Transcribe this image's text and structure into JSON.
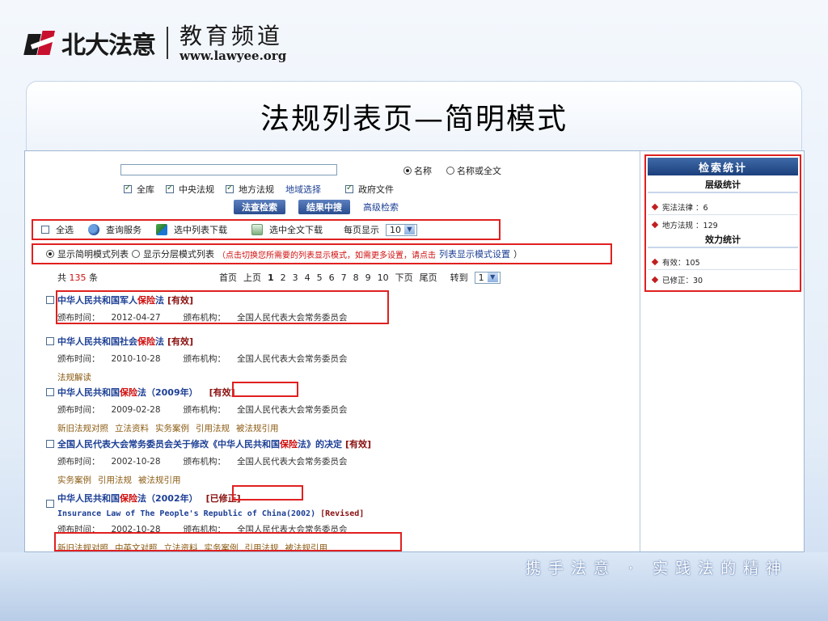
{
  "header": {
    "brand": "北大法意",
    "channel": "教育频道",
    "url": "www.lawyee.org"
  },
  "slide_title": "法规列表页—简明模式",
  "search": {
    "radio_name": "名称",
    "radio_fulltext": "名称或全文",
    "check_all": "全库",
    "check_central": "中央法规",
    "check_local": "地方法规",
    "link_region": "地域选择",
    "check_gov": "政府文件",
    "btn_search": "法查检索",
    "btn_in_results": "结果中搜",
    "link_advanced": "高级检索"
  },
  "toolbar": {
    "select_all": "全选",
    "query_service": "查询服务",
    "download_list": "选中列表下载",
    "download_full": "选中全文下载",
    "per_page_label": "每页显示",
    "per_page_value": "10"
  },
  "mode_bar": {
    "simple_mode": "显示简明模式列表",
    "layered_mode": "显示分层模式列表",
    "hint_prefix": "（点击切换您所需要的列表显示模式，如需更多设置，请点击",
    "hint_link": "列表显示模式设置",
    "hint_suffix": "）"
  },
  "pager": {
    "total_prefix": "共",
    "total_count": "135",
    "total_suffix": "条",
    "first": "首页",
    "prev": "上页",
    "pages": [
      "1",
      "2",
      "3",
      "4",
      "5",
      "6",
      "7",
      "8",
      "9",
      "10"
    ],
    "next": "下页",
    "last": "尾页",
    "goto_label": "转到",
    "goto_value": "1"
  },
  "records": [
    {
      "title_pre": "中华人民共和国军人",
      "title_hl": "保险",
      "title_post": "法",
      "status": "[有效]",
      "date_label": "颁布时间：",
      "date": "2012-04-27",
      "org_label": "颁布机构：",
      "org": "全国人民代表大会常务委员会",
      "links": []
    },
    {
      "title_pre": "中华人民共和国社会",
      "title_hl": "保险",
      "title_post": "法",
      "status": "[有效]",
      "date_label": "颁布时间：",
      "date": "2010-10-28",
      "org_label": "颁布机构：",
      "org": "全国人民代表大会常务委员会",
      "links": [
        "法规解读"
      ]
    },
    {
      "title_pre": "中华人民共和国",
      "title_hl": "保险",
      "title_post": "法（2009年）",
      "status": "[有效]",
      "date_label": "颁布时间：",
      "date": "2009-02-28",
      "org_label": "颁布机构：",
      "org": "全国人民代表大会常务委员会",
      "links": [
        "新旧法规对照",
        "立法资料",
        "实务案例",
        "引用法规",
        "被法规引用"
      ]
    },
    {
      "title_pre": "全国人民代表大会常务委员会关于修改《中华人民共和国",
      "title_hl": "保险",
      "title_post": "法》的决定",
      "status": "[有效]",
      "date_label": "颁布时间：",
      "date": "2002-10-28",
      "org_label": "颁布机构：",
      "org": "全国人民代表大会常务委员会",
      "links": [
        "实务案例",
        "引用法规",
        "被法规引用"
      ]
    },
    {
      "title_pre": "中华人民共和国",
      "title_hl": "保险",
      "title_post": "法（2002年）",
      "status": "[已修正]",
      "en_title": "Insurance Law of The People's Republic of China(2002)",
      "en_status": "[Revised]",
      "date_label": "颁布时间：",
      "date": "2002-10-28",
      "org_label": "颁布机构：",
      "org": "全国人民代表大会常务委员会",
      "links": [
        "新旧法规对照",
        "中英文对照",
        "立法资料",
        "实务案例",
        "引用法规",
        "被法规引用"
      ]
    }
  ],
  "sidebar": {
    "title": "检索统计",
    "level_title": "层级统计",
    "level_items": [
      "宪法法律 ：6",
      "地方法规 ：129"
    ],
    "effect_title": "效力统计",
    "effect_items": [
      "有效：105",
      "已修正：30"
    ]
  },
  "footer": {
    "slogan": "携手法意 · 实践法的精神"
  }
}
